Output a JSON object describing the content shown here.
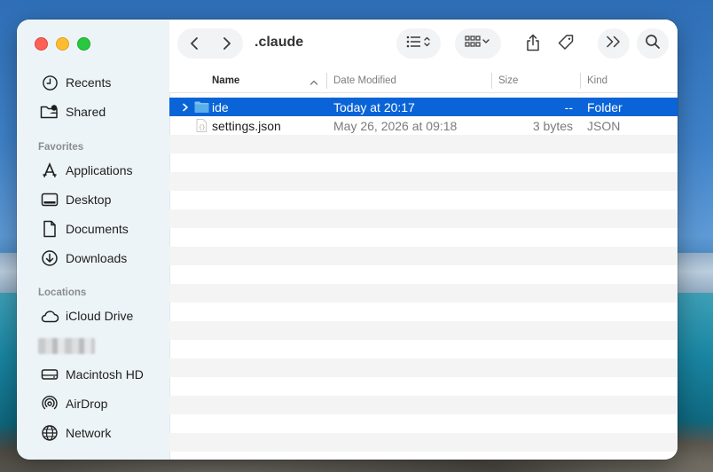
{
  "window": {
    "title": ".claude"
  },
  "sidebar": {
    "items_top": [
      {
        "label": "Recents",
        "icon": "clock-icon"
      },
      {
        "label": "Shared",
        "icon": "shared-folder-icon"
      }
    ],
    "favorites_heading": "Favorites",
    "favorites": [
      {
        "label": "Applications",
        "icon": "applications-icon"
      },
      {
        "label": "Desktop",
        "icon": "desktop-icon"
      },
      {
        "label": "Documents",
        "icon": "document-icon"
      },
      {
        "label": "Downloads",
        "icon": "download-icon"
      }
    ],
    "locations_heading": "Locations",
    "locations": [
      {
        "label": "iCloud Drive",
        "icon": "cloud-icon"
      },
      {
        "label": "Macintosh HD",
        "icon": "hard-drive-icon"
      },
      {
        "label": "AirDrop",
        "icon": "airdrop-icon"
      },
      {
        "label": "Network",
        "icon": "globe-icon"
      }
    ]
  },
  "columns": {
    "name": "Name",
    "date": "Date Modified",
    "size": "Size",
    "kind": "Kind"
  },
  "files": [
    {
      "name": "ide",
      "date": "Today at 20:17",
      "size": "--",
      "kind": "Folder",
      "selected": true
    },
    {
      "name": "settings.json",
      "date": "May 26, 2026 at 09:18",
      "size": "3 bytes",
      "kind": "JSON",
      "selected": false
    }
  ],
  "colors": {
    "selection": "#0a64d7",
    "accent_icon": "#0a64d7",
    "folder": "#6fb2e8"
  }
}
